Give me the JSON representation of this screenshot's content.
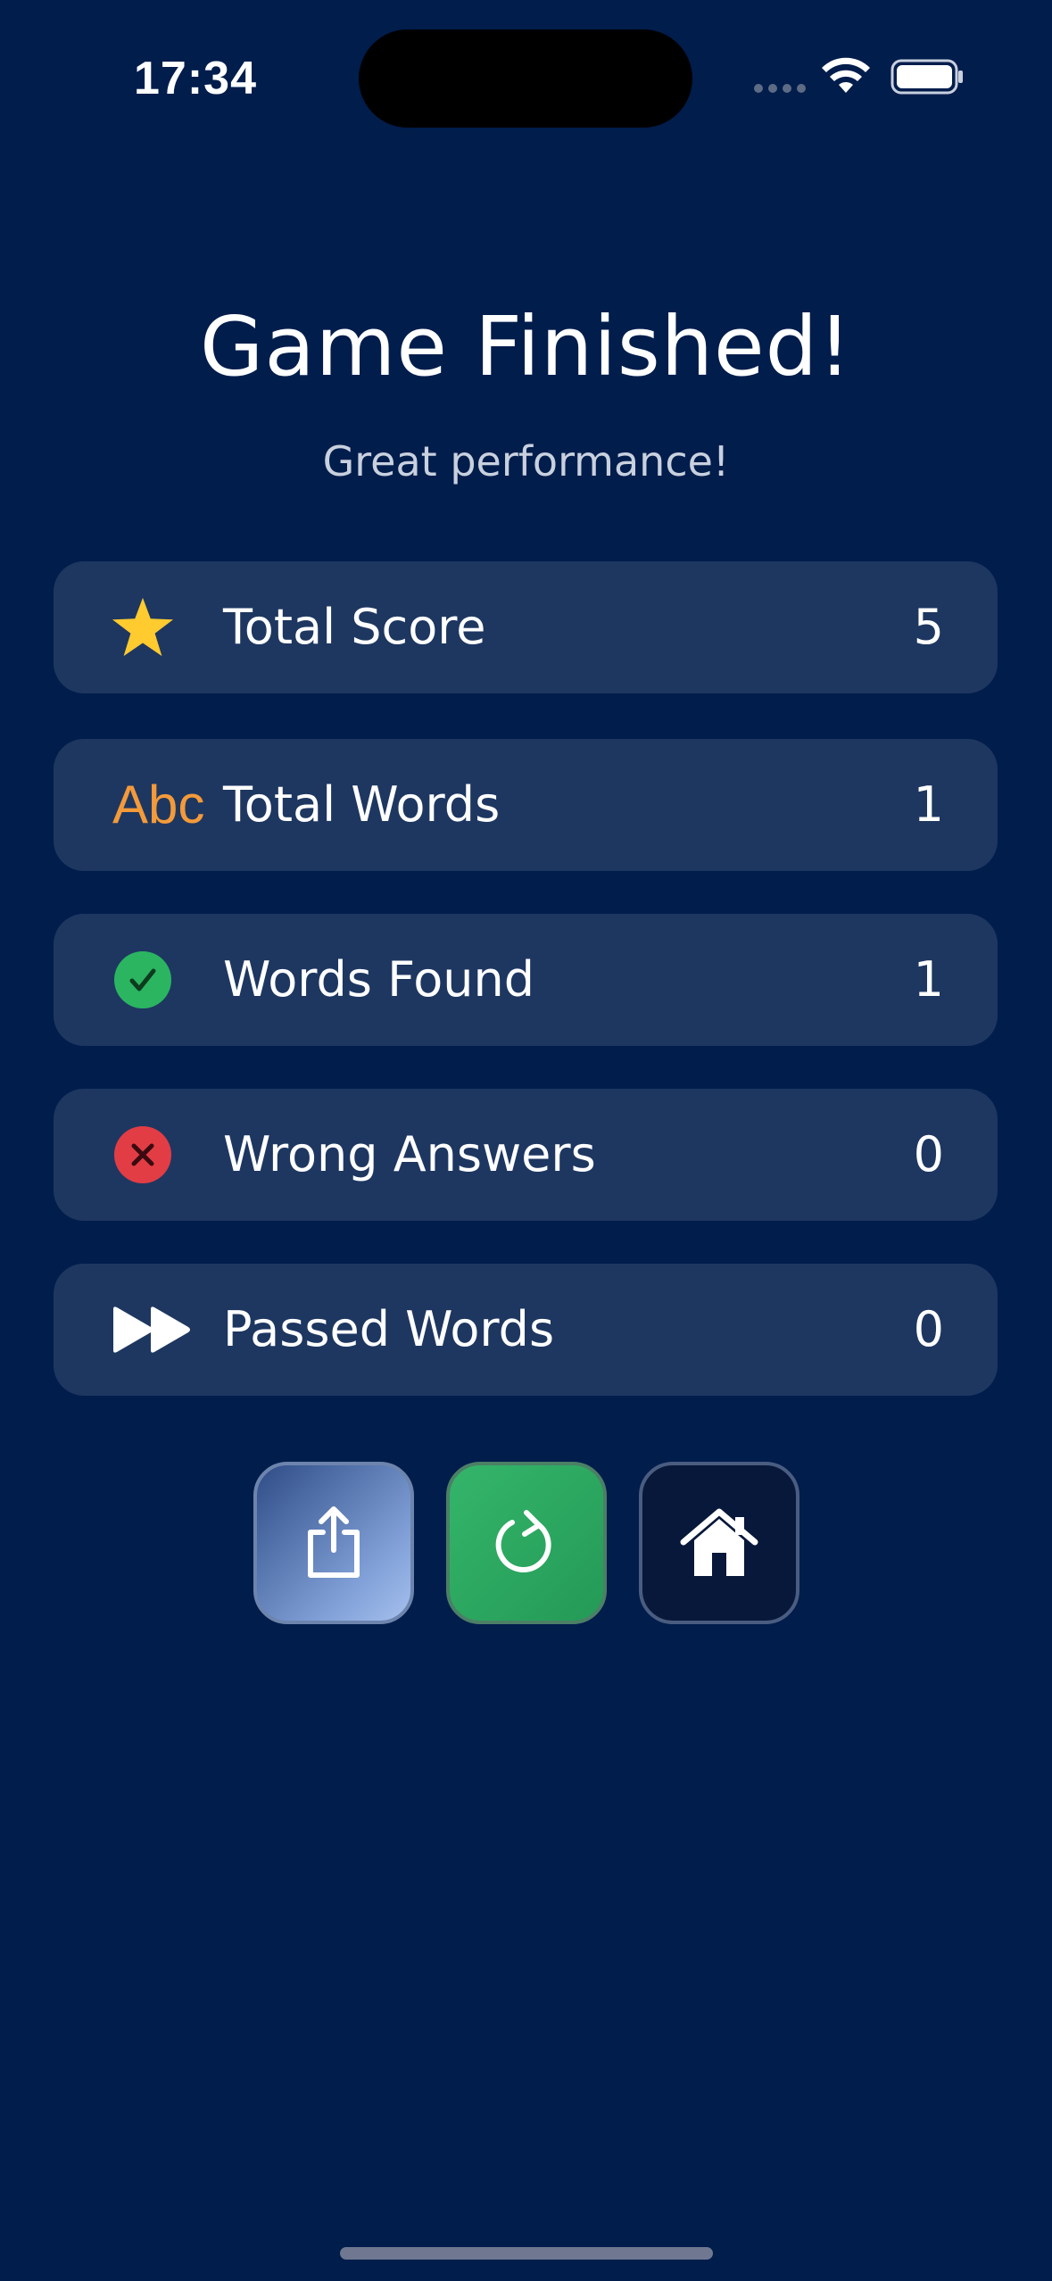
{
  "status_bar": {
    "time": "17:34"
  },
  "header": {
    "title": "Game Finished!",
    "subtitle": "Great performance!"
  },
  "stats": [
    {
      "label": "Total Score",
      "value": "5",
      "icon": "star-icon",
      "color": "#ffcb2f"
    },
    {
      "label": "Total Words",
      "value": "1",
      "icon": "abc-icon",
      "icon_text": "Abc",
      "color": "#f39a3a"
    },
    {
      "label": "Words Found",
      "value": "1",
      "icon": "checkmark-circle-icon",
      "color": "#2bb561"
    },
    {
      "label": "Wrong Answers",
      "value": "0",
      "icon": "x-circle-icon",
      "color": "#e23d45"
    },
    {
      "label": "Passed Words",
      "value": "0",
      "icon": "fast-forward-icon",
      "color": "#ffffff"
    }
  ],
  "actions": [
    {
      "name": "share",
      "icon": "share-icon"
    },
    {
      "name": "replay",
      "icon": "refresh-icon"
    },
    {
      "name": "home",
      "icon": "home-icon"
    }
  ],
  "colors": {
    "background": "#001d4c",
    "card": "#1e3761",
    "accent_green": "#2bb561",
    "accent_red": "#e23d45",
    "accent_gold": "#ffcb2f",
    "accent_orange": "#f39a3a"
  }
}
